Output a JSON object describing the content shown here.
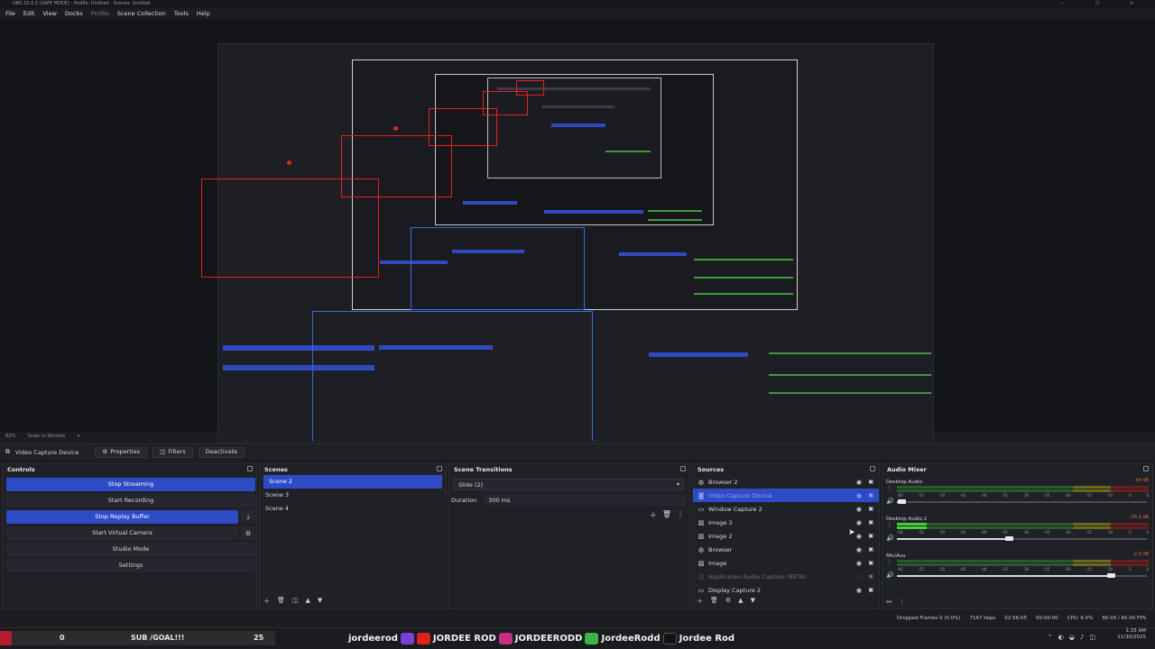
{
  "window": {
    "title": "OBS 32.0.2 (SAFE MODE) - Profile: Untitled - Scenes: Untitled",
    "controls": [
      "—",
      "☐",
      "✕"
    ]
  },
  "menu": {
    "items": [
      {
        "label": "File"
      },
      {
        "label": "Edit"
      },
      {
        "label": "View"
      },
      {
        "label": "Docks"
      },
      {
        "label": "Profile"
      },
      {
        "label": "Scene Collection"
      },
      {
        "label": "Tools"
      },
      {
        "label": "Help"
      }
    ]
  },
  "preview_bar": {
    "zoom": "82%",
    "scale": "Scale to Window"
  },
  "source_toolbar": {
    "source_name": "Video Capture Device",
    "properties": "Properties",
    "filters": "Filters",
    "deactivate": "Deactivate"
  },
  "controls": {
    "title": "Controls",
    "stop_streaming": "Stop Streaming",
    "start_recording": "Start Recording",
    "stop_replay_buffer": "Stop Replay Buffer",
    "start_virtual_camera": "Start Virtual Camera",
    "studio_mode": "Studio Mode",
    "settings": "Settings"
  },
  "scenes": {
    "title": "Scenes",
    "items": [
      {
        "label": "Scene 2"
      },
      {
        "label": "Scene 3"
      },
      {
        "label": "Scene 4"
      }
    ]
  },
  "transitions": {
    "title": "Scene Transitions",
    "selected": "Slide (2)",
    "duration_label": "Duration",
    "duration_value": "300 ms"
  },
  "sources": {
    "title": "Sources",
    "items": [
      {
        "label": "Browser 2",
        "icon": "globe-icon"
      },
      {
        "label": "Video Capture Device",
        "icon": "camera-icon"
      },
      {
        "label": "Window Capture 2",
        "icon": "window-icon"
      },
      {
        "label": "Image 3",
        "icon": "image-icon"
      },
      {
        "label": "Image 2",
        "icon": "image-icon"
      },
      {
        "label": "Browser",
        "icon": "globe-icon"
      },
      {
        "label": "Image",
        "icon": "image-icon"
      },
      {
        "label": "Application Audio Capture (BETA)",
        "icon": "app-audio-icon"
      },
      {
        "label": "Display Capture 2",
        "icon": "monitor-icon"
      }
    ]
  },
  "mixer": {
    "title": "Audio Mixer",
    "channels": [
      {
        "name": "Desktop Audio",
        "db": "-inf dB",
        "level": 0.0,
        "volume": 0.02
      },
      {
        "name": "Desktop Audio 2",
        "db": "-25.2 dB",
        "level": 0.12,
        "volume": 0.45
      },
      {
        "name": "Mic/Aux",
        "db": "-2.5 dB",
        "level": 0.0,
        "volume": 0.86
      }
    ],
    "ticks": [
      "-60",
      "-55",
      "-50",
      "-45",
      "-40",
      "-35",
      "-30",
      "-25",
      "-20",
      "-15",
      "-10",
      "-5",
      "0"
    ]
  },
  "status": {
    "dropped": "Dropped Frames 0 (0.0%)",
    "bitrate": "7167 kbps",
    "live_time": "02:56:05",
    "rec_time": "00:00:00",
    "cpu": "CPU: 6.0%",
    "fps": "60.00 / 60.00 FPS"
  },
  "overlay": {
    "count_left": "0",
    "goal": "SUB /GOAL!!!",
    "count_right": "25",
    "socials": [
      "jordeerod",
      "JORDEE ROD",
      "JORDEERODD",
      "JordeeRodd",
      "Jordee Rod"
    ]
  },
  "tray": {
    "time": "1:33 AM",
    "date": "11/30/2025"
  },
  "colors": {
    "accent": "#2e4bc6",
    "highlight_red": "#e0221d",
    "meter_green": "#43d13a"
  }
}
